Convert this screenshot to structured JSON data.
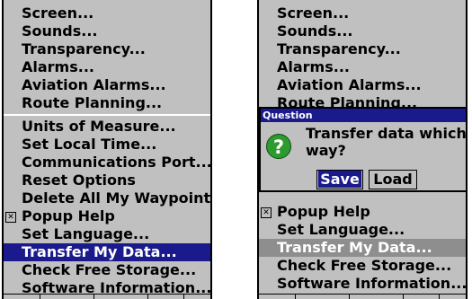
{
  "left_menu": {
    "items_top": [
      {
        "label": "Screen..."
      },
      {
        "label": "Sounds..."
      },
      {
        "label": "Transparency..."
      },
      {
        "label": "Alarms..."
      },
      {
        "label": "Aviation Alarms..."
      },
      {
        "label": "Route Planning..."
      }
    ],
    "items_bottom": [
      {
        "label": "Units of Measure..."
      },
      {
        "label": "Set Local Time..."
      },
      {
        "label": "Communications Port..."
      },
      {
        "label": "Reset Options"
      },
      {
        "label": "Delete All My Waypoints"
      },
      {
        "label": "Popup Help",
        "checkbox": "✕"
      },
      {
        "label": "Set Language..."
      },
      {
        "label": "Transfer My Data...",
        "selected": true
      },
      {
        "label": "Check Free Storage..."
      },
      {
        "label": "Software Information..."
      }
    ]
  },
  "right_menu": {
    "items_top": [
      {
        "label": "Screen..."
      },
      {
        "label": "Sounds..."
      },
      {
        "label": "Transparency..."
      },
      {
        "label": "Alarms..."
      },
      {
        "label": "Aviation Alarms..."
      },
      {
        "label": "Route Planning..."
      }
    ],
    "items_bottom": [
      {
        "label": "Popup Help",
        "checkbox": "✕"
      },
      {
        "label": "Set Language..."
      },
      {
        "label": "Transfer My Data...",
        "selected": true
      },
      {
        "label": "Check Free Storage..."
      },
      {
        "label": "Software Information..."
      }
    ]
  },
  "dialog": {
    "title": "Question",
    "icon": "question-icon",
    "icon_glyph": "?",
    "message": "Transfer data which way?",
    "save_label": "Save",
    "load_label": "Load"
  },
  "colors": {
    "panel_bg": "#c0c0c0",
    "selection_blue": "#1a1a8c",
    "selection_gray": "#8e8e8e",
    "icon_green": "#2e9b2e"
  }
}
